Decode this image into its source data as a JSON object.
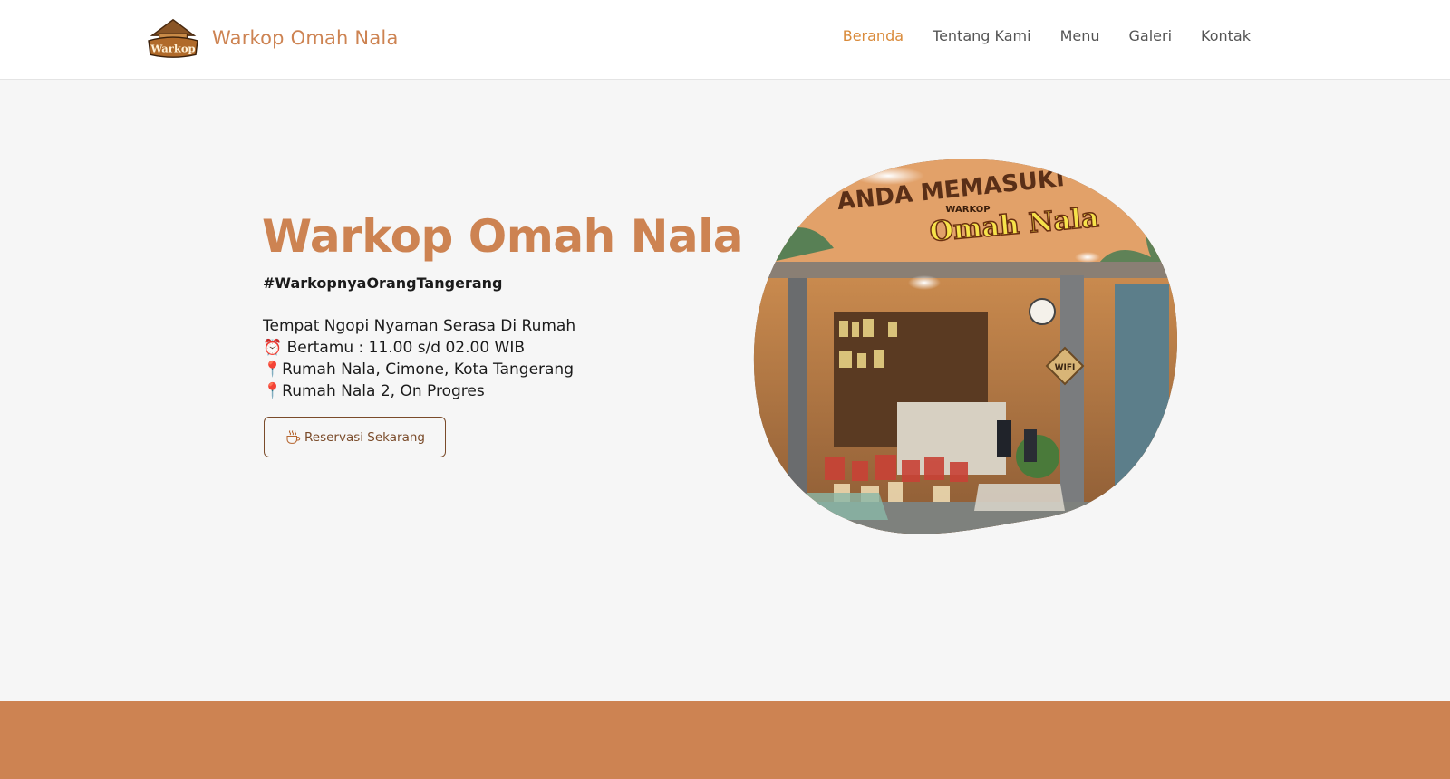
{
  "brand": {
    "name": "Warkop Omah Nala",
    "logo_text": "Warkop",
    "logo_icon": "warkop-logo-icon"
  },
  "nav": {
    "items": [
      {
        "label": "Beranda",
        "active": true
      },
      {
        "label": "Tentang Kami",
        "active": false
      },
      {
        "label": "Menu",
        "active": false
      },
      {
        "label": "Galeri",
        "active": false
      },
      {
        "label": "Kontak",
        "active": false
      }
    ]
  },
  "hero": {
    "title": "Warkop Omah Nala",
    "hashtag": "#WarkopnyaOrangTangerang",
    "tagline": "Tempat Ngopi Nyaman Serasa Di Rumah",
    "hours": "⏰ Bertamu : 11.00 s/d 02.00 WIB",
    "location_1": "📍Rumah Nala, Cimone, Kota Tangerang",
    "location_2": "📍Rumah Nala 2, On Progres",
    "cta_label": "Reservasi Sekarang",
    "cta_icon": "hot-coffee-cup-icon",
    "photo_signage": "ANDA MEMASUKI",
    "photo_sign_small": "WARKOP",
    "photo_sign_big": "Omah Nala",
    "photo_wifi_sign": "WIFI"
  },
  "colors": {
    "accent": "#cd8352",
    "nav_active": "#d98a3a",
    "footer_band": "#cd8352",
    "background": "#f6f6f6"
  }
}
